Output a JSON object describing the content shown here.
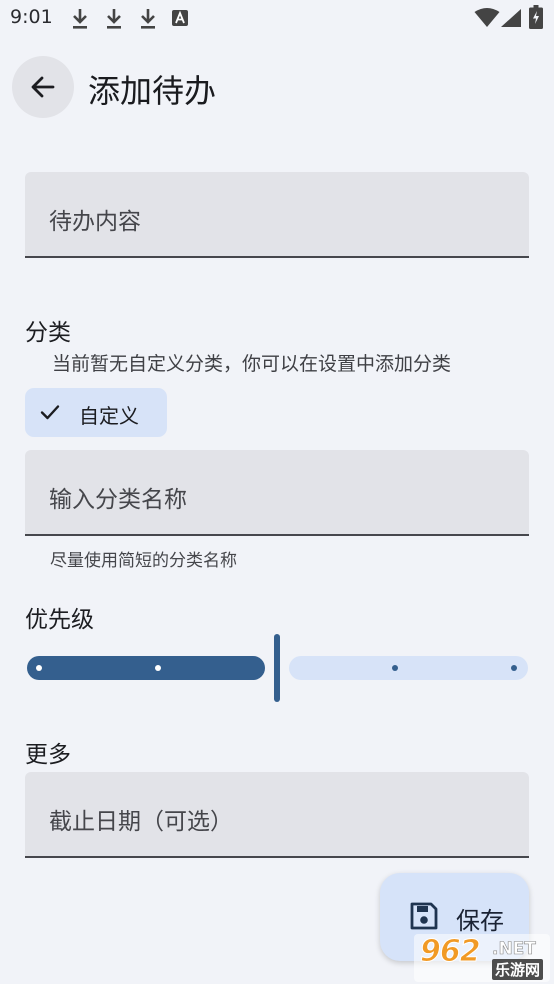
{
  "status_bar": {
    "time": "9:01",
    "notification_icons": [
      "download-icon",
      "download-icon",
      "download-icon",
      "a-letter-icon"
    ],
    "system_icons": [
      "wifi-icon",
      "signal-icon",
      "battery-charging-icon"
    ]
  },
  "app_bar": {
    "back_icon": "arrow-left-icon",
    "title": "添加待办"
  },
  "form": {
    "content_field": {
      "placeholder": "待办内容",
      "value": ""
    },
    "category": {
      "title": "分类",
      "hint": "当前暂无自定义分类，你可以在设置中添加分类",
      "chip": {
        "label": "自定义",
        "selected": true,
        "icon": "check-icon"
      },
      "name_field": {
        "placeholder": "输入分类名称",
        "value": ""
      },
      "helper": "尽量使用简短的分类名称"
    },
    "priority": {
      "title": "优先级",
      "slider": {
        "min": 0,
        "max": 4,
        "value": 2,
        "steps": 5
      }
    },
    "more": {
      "title": "更多",
      "deadline_field": {
        "placeholder": "截止日期（可选）",
        "value": ""
      }
    }
  },
  "fab": {
    "label": "保存",
    "icon": "save-icon"
  },
  "watermark": {
    "logo": "962",
    "domain": ".NET",
    "site_name": "乐游网"
  },
  "colors": {
    "background": "#f1f3f8",
    "field_background": "#e2e3e8",
    "accent": "#345f8e",
    "accent_light": "#d7e3f8"
  }
}
